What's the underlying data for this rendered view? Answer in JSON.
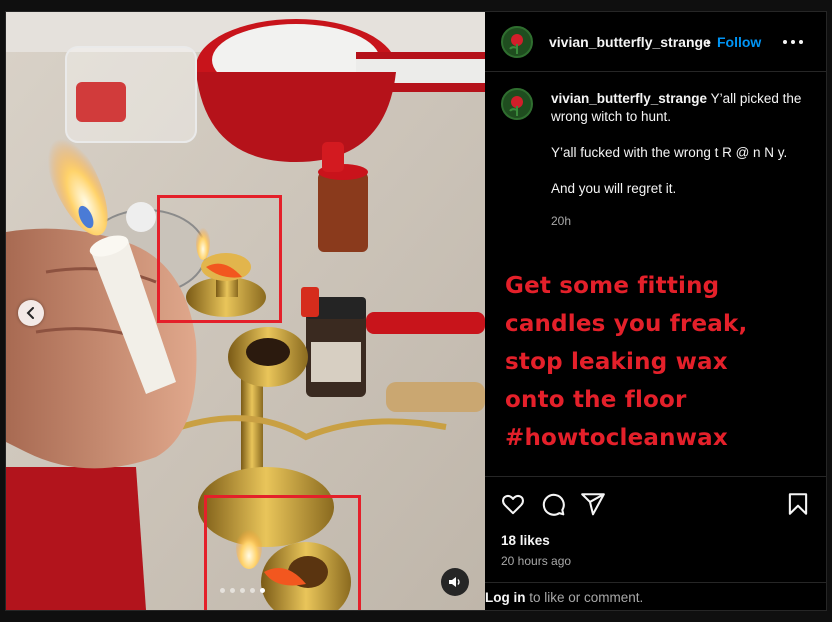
{
  "post": {
    "username": "vivian_butterfly_strange",
    "separator": "•",
    "follow_label": "Follow",
    "more_icon": "more-horizontal-icon"
  },
  "caption": {
    "username": "vivian_butterfly_strange",
    "line1": "Y’all picked the wrong witch to hunt.",
    "line2": "Y’all fucked with the wrong t R @ n N y.",
    "line3": "And you will regret it.",
    "time": "20h"
  },
  "overlay": {
    "lines": [
      "Get some fitting",
      "candles you freak,",
      "stop leaking wax",
      "onto the floor",
      "#howtocleanwax"
    ],
    "color": "#e4202a"
  },
  "media": {
    "carousel_slides": 5,
    "active_slide": 5,
    "prev_icon": "chevron-left-icon",
    "audio_icon": "speaker-icon",
    "highlight_color": "#e4202a"
  },
  "actions": {
    "like_icon": "heart-icon",
    "comment_icon": "comment-icon",
    "share_icon": "send-icon",
    "save_icon": "bookmark-icon"
  },
  "likes": "18 likes",
  "posted": "20 hours ago",
  "comment_prompt": {
    "login_label": "Log in",
    "rest": " to like or comment."
  },
  "colors": {
    "accent": "#0095f6",
    "background": "#000000",
    "muted": "#a8a8a8"
  }
}
